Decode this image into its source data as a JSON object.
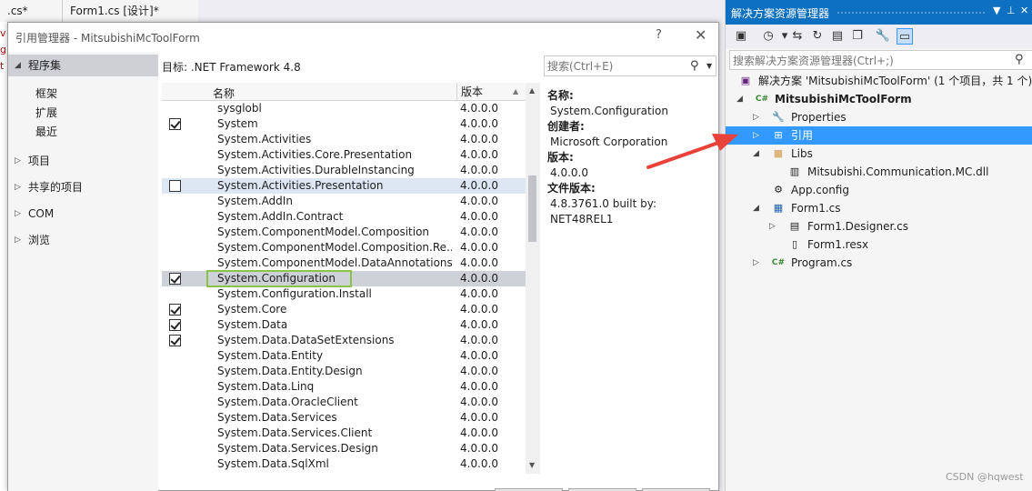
{
  "editor": {
    "tab1": ".cs*",
    "tab2": "Form1.cs [设计]*"
  },
  "dialog": {
    "title": "引用管理器 - MitsubishiMcToolForm",
    "help": "?",
    "close": "✕",
    "target": "目标: .NET Framework 4.8",
    "search_placeholder": "搜索(Ctrl+E)",
    "nav": {
      "assemblies": "程序集",
      "framework": "框架",
      "extensions": "扩展",
      "recent": "最近",
      "projects": "项目",
      "shared": "共享的项目",
      "com": "COM",
      "browse": "浏览"
    },
    "columns": {
      "name": "名称",
      "version": "版本"
    },
    "rows": [
      {
        "name": "sysglobl",
        "version": "4.0.0.0",
        "checked": false,
        "cb": false
      },
      {
        "name": "System",
        "version": "4.0.0.0",
        "checked": true,
        "cb": true
      },
      {
        "name": "System.Activities",
        "version": "4.0.0.0",
        "checked": false,
        "cb": false
      },
      {
        "name": "System.Activities.Core.Presentation",
        "version": "4.0.0.0",
        "checked": false,
        "cb": false
      },
      {
        "name": "System.Activities.DurableInstancing",
        "version": "4.0.0.0",
        "checked": false,
        "cb": false
      },
      {
        "name": "System.Activities.Presentation",
        "version": "4.0.0.0",
        "checked": false,
        "cb": true
      },
      {
        "name": "System.AddIn",
        "version": "4.0.0.0",
        "checked": false,
        "cb": false
      },
      {
        "name": "System.AddIn.Contract",
        "version": "4.0.0.0",
        "checked": false,
        "cb": false
      },
      {
        "name": "System.ComponentModel.Composition",
        "version": "4.0.0.0",
        "checked": false,
        "cb": false
      },
      {
        "name": "System.ComponentModel.Composition.Re...",
        "version": "4.0.0.0",
        "checked": false,
        "cb": false
      },
      {
        "name": "System.ComponentModel.DataAnnotations",
        "version": "4.0.0.0",
        "checked": false,
        "cb": false
      },
      {
        "name": "System.Configuration",
        "version": "4.0.0.0",
        "checked": true,
        "cb": true
      },
      {
        "name": "System.Configuration.Install",
        "version": "4.0.0.0",
        "checked": false,
        "cb": false
      },
      {
        "name": "System.Core",
        "version": "4.0.0.0",
        "checked": true,
        "cb": true
      },
      {
        "name": "System.Data",
        "version": "4.0.0.0",
        "checked": true,
        "cb": true
      },
      {
        "name": "System.Data.DataSetExtensions",
        "version": "4.0.0.0",
        "checked": true,
        "cb": true
      },
      {
        "name": "System.Data.Entity",
        "version": "4.0.0.0",
        "checked": false,
        "cb": false
      },
      {
        "name": "System.Data.Entity.Design",
        "version": "4.0.0.0",
        "checked": false,
        "cb": false
      },
      {
        "name": "System.Data.Linq",
        "version": "4.0.0.0",
        "checked": false,
        "cb": false
      },
      {
        "name": "System.Data.OracleClient",
        "version": "4.0.0.0",
        "checked": false,
        "cb": false
      },
      {
        "name": "System.Data.Services",
        "version": "4.0.0.0",
        "checked": false,
        "cb": false
      },
      {
        "name": "System.Data.Services.Client",
        "version": "4.0.0.0",
        "checked": false,
        "cb": false
      },
      {
        "name": "System.Data.Services.Design",
        "version": "4.0.0.0",
        "checked": false,
        "cb": false
      },
      {
        "name": "System.Data.SqlXml",
        "version": "4.0.0.0",
        "checked": false,
        "cb": false
      }
    ],
    "hover_row": 5,
    "selected_row": 11,
    "details": {
      "name_label": "名称:",
      "name_value": "System.Configuration",
      "creator_label": "创建者:",
      "creator_value": "Microsoft Corporation",
      "version_label": "版本:",
      "version_value": "4.0.0.0",
      "file_version_label": "文件版本:",
      "file_version_value": "4.8.3761.0 built by: NET48REL1"
    }
  },
  "solution_explorer": {
    "title": "解决方案资源管理器",
    "search_placeholder": "搜索解决方案资源管理器(Ctrl+;)",
    "tree": {
      "solution": "解决方案 'MitsubishiMcToolForm' (1 个项目，共 1 个)",
      "project": "MitsubishiMcToolForm",
      "properties": "Properties",
      "references": "引用",
      "libs": "Libs",
      "dll": "Mitsubishi.Communication.MC.dll",
      "appconfig": "App.config",
      "form1": "Form1.cs",
      "form1_designer": "Form1.Designer.cs",
      "form1_resx": "Form1.resx",
      "program": "Program.cs"
    }
  },
  "watermark": "CSDN @hqwest",
  "colors": {
    "accent": "#0e70c0",
    "selection": "#3399ff",
    "highlight_box": "#8bc34a",
    "arrow": "#e8423a"
  }
}
